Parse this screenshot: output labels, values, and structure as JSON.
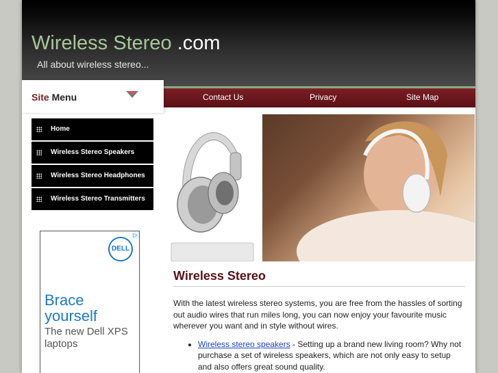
{
  "header": {
    "title_part1": "Wireless Stereo",
    "title_part2": " .com",
    "tagline": "All about wireless stereo..."
  },
  "nav": {
    "items": [
      {
        "label": "Contact Us"
      },
      {
        "label": "Privacy"
      },
      {
        "label": "Site Map"
      }
    ]
  },
  "sidebar": {
    "menu_title_accent": "Site",
    "menu_title_rest": " Menu",
    "items": [
      {
        "label": "Home"
      },
      {
        "label": "Wireless Stereo Speakers"
      },
      {
        "label": "Wireless Stereo Headphones"
      },
      {
        "label": "Wireless Stereo Transmitters"
      }
    ]
  },
  "ad": {
    "brand": "DELL",
    "headline": "Brace yourself",
    "subtext": "The new Dell XPS laptops"
  },
  "main": {
    "heading": "Wireless Stereo",
    "intro": "With the latest wireless stereo systems, you are free from the hassles of sorting out audio wires that run miles long, you can now enjoy your favourite music wherever you want and in style without wires.",
    "list": [
      {
        "link_text": "Wireless stereo speakers",
        "text": " - Setting up a brand new living room? Why not purchase a set of wireless speakers, which are not only easy to setup and also offers great sound quality."
      }
    ]
  }
}
